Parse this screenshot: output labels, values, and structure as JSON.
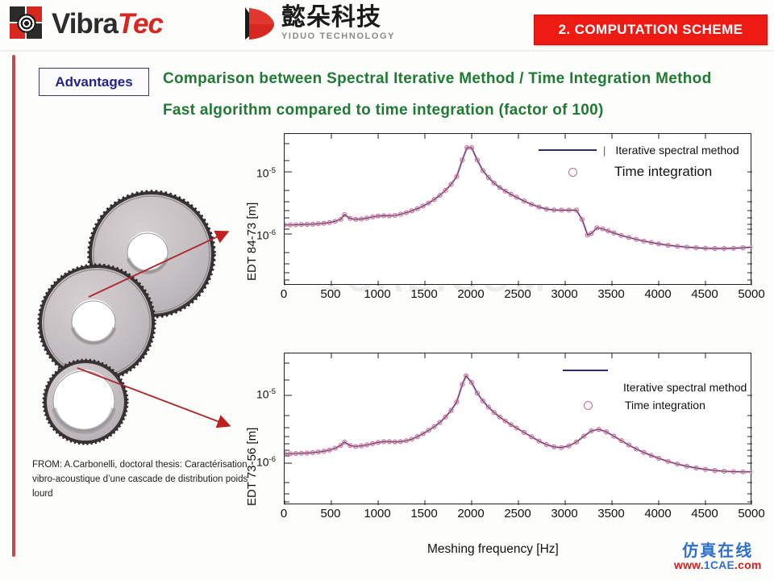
{
  "header": {
    "vibratec_logo_text": "VibraTec",
    "vibratec_name_main": "Vibra",
    "vibratec_name_accent": "Tec",
    "yiduo_cn": "懿朵科技",
    "yiduo_en": "YIDUO TECHNOLOGY",
    "banner_label": "2. COMPUTATION SCHEME",
    "banner_color": "#ee1b15"
  },
  "title": {
    "badge": "Advantages",
    "line1": "Comparison between  Spectral Iterative Method / Time Integration Method",
    "line2": "Fast algorithm compared to time integration  (factor of 100)",
    "color": "#1f7a33",
    "badge_color": "#231f8f"
  },
  "source_note": "FROM: A.Carbonelli,  doctoral thesis: Caractérisation vibro-acoustique d’une cascade de distribution poids lourd",
  "xlabel_shared": "Meshing  frequency [Hz]",
  "watermark": {
    "center": "1CAE.COM",
    "cn": "仿真在线",
    "url_prefix": "www.",
    "url_mid": "1CAE",
    "url_suffix": ".com"
  },
  "chart_data": [
    {
      "id": "top",
      "type": "line",
      "title": "",
      "xlabel": "Meshing  frequency [Hz]",
      "ylabel": "EDT 84-73 [m]",
      "xlim": [
        0,
        5000
      ],
      "ylim": [
        3e-07,
        5e-05
      ],
      "yscale": "log",
      "xticks": [
        0,
        500,
        1000,
        1500,
        2000,
        2500,
        3000,
        3500,
        4000,
        4500,
        5000
      ],
      "xticklabels": [
        "0",
        "500",
        "1000",
        "1500",
        "2000",
        "2500",
        "3000",
        "3500",
        "4000",
        "4500",
        "5000"
      ],
      "yticks": [
        1e-06,
        1e-05
      ],
      "yticklabels": [
        "10-6",
        "10-5"
      ],
      "grid": false,
      "legend_position": "upper right",
      "series": [
        {
          "name": "Iterative spectral method",
          "style": "line",
          "color": "#2b2f6e",
          "x": [
            0,
            60,
            120,
            180,
            240,
            300,
            360,
            420,
            480,
            540,
            600,
            640,
            700,
            760,
            820,
            880,
            940,
            1000,
            1060,
            1120,
            1180,
            1240,
            1300,
            1360,
            1420,
            1480,
            1540,
            1600,
            1660,
            1720,
            1780,
            1840,
            1900,
            1950,
            2000,
            2060,
            2120,
            2180,
            2240,
            2300,
            2360,
            2420,
            2480,
            2560,
            2640,
            2720,
            2800,
            2880,
            2960,
            3040,
            3120,
            3180,
            3240,
            3280,
            3340,
            3400,
            3460,
            3520,
            3600,
            3680,
            3760,
            3840,
            3920,
            4000,
            4100,
            4200,
            4300,
            4400,
            4500,
            4600,
            4700,
            4800,
            4900,
            5000
          ],
          "y": [
            1.4e-06,
            1.4e-06,
            1.41e-06,
            1.42e-06,
            1.43e-06,
            1.44e-06,
            1.46e-06,
            1.49e-06,
            1.53e-06,
            1.6e-06,
            1.72e-06,
            2.05e-06,
            1.78e-06,
            1.72e-06,
            1.74e-06,
            1.8e-06,
            1.88e-06,
            1.95e-06,
            1.97e-06,
            1.96e-06,
            1.99e-06,
            2.08e-06,
            2.2e-06,
            2.36e-06,
            2.56e-06,
            2.82e-06,
            3.15e-06,
            3.6e-06,
            4.2e-06,
            5.05e-06,
            6.3e-06,
            8.4e-06,
            1.55e-05,
            2.45e-05,
            2.45e-05,
            1.55e-05,
            1.05e-05,
            8.1e-06,
            6.6e-06,
            5.6e-06,
            4.9e-06,
            4.35e-06,
            3.9e-06,
            3.4e-06,
            3e-06,
            2.72e-06,
            2.52e-06,
            2.44e-06,
            2.42e-06,
            2.42e-06,
            2.42e-06,
            1.72e-06,
            9.6e-07,
            1.02e-06,
            1.26e-06,
            1.21e-06,
            1.12e-06,
            1.04e-06,
            9.5e-07,
            8.8e-07,
            8.2e-07,
            7.7e-07,
            7.3e-07,
            6.95e-07,
            6.6e-07,
            6.35e-07,
            6.15e-07,
            6e-07,
            5.9e-07,
            5.85e-07,
            5.85e-07,
            5.9e-07,
            6e-07,
            6.15e-07
          ]
        },
        {
          "name": "Time integration",
          "style": "markers",
          "color": "#c86a8e",
          "marker": "circle"
        }
      ]
    },
    {
      "id": "bottom",
      "type": "line",
      "title": "",
      "xlabel": "Meshing  frequency [Hz]",
      "ylabel": "EDT 73-56 [m]",
      "xlim": [
        0,
        5000
      ],
      "ylim": [
        3e-07,
        5e-05
      ],
      "yscale": "log",
      "xticks": [
        0,
        500,
        1000,
        1500,
        2000,
        2500,
        3000,
        3500,
        4000,
        4500,
        5000
      ],
      "xticklabels": [
        "0",
        "500",
        "1000",
        "1500",
        "2000",
        "2500",
        "3000",
        "3500",
        "4000",
        "4500",
        "5000"
      ],
      "yticks": [
        1e-06,
        1e-05
      ],
      "yticklabels": [
        "10-6",
        "10-5"
      ],
      "grid": false,
      "legend_position": "upper right",
      "series": [
        {
          "name": "Iterative spectral method",
          "style": "line",
          "color": "#2b2f6e",
          "x": [
            0,
            60,
            120,
            180,
            240,
            300,
            360,
            420,
            480,
            540,
            600,
            640,
            700,
            760,
            820,
            880,
            940,
            1000,
            1060,
            1120,
            1180,
            1240,
            1300,
            1360,
            1420,
            1480,
            1540,
            1600,
            1660,
            1720,
            1780,
            1840,
            1900,
            1940,
            2000,
            2060,
            2120,
            2180,
            2240,
            2300,
            2360,
            2420,
            2480,
            2560,
            2640,
            2720,
            2800,
            2880,
            2960,
            3040,
            3120,
            3200,
            3280,
            3360,
            3440,
            3520,
            3600,
            3680,
            3760,
            3840,
            3920,
            4000,
            4100,
            4200,
            4300,
            4400,
            4500,
            4600,
            4700,
            4800,
            4900,
            5000
          ],
          "y": [
            1.38e-06,
            1.38e-06,
            1.39e-06,
            1.4e-06,
            1.41e-06,
            1.43e-06,
            1.46e-06,
            1.5e-06,
            1.56e-06,
            1.66e-06,
            1.82e-06,
            2.05e-06,
            1.82e-06,
            1.76e-06,
            1.8e-06,
            1.86e-06,
            1.94e-06,
            2.02e-06,
            2.08e-06,
            2.08e-06,
            2.06e-06,
            2.08e-06,
            2.14e-06,
            2.26e-06,
            2.46e-06,
            2.72e-06,
            3.05e-06,
            3.45e-06,
            4e-06,
            4.8e-06,
            6e-06,
            8e-06,
            1.45e-05,
            1.95e-05,
            1.55e-05,
            1.08e-05,
            8.3e-06,
            6.7e-06,
            5.6e-06,
            4.8e-06,
            4.2e-06,
            3.7e-06,
            3.3e-06,
            2.85e-06,
            2.45e-06,
            2.12e-06,
            1.88e-06,
            1.74e-06,
            1.7e-06,
            1.8e-06,
            2.05e-06,
            2.5e-06,
            3e-06,
            3.15e-06,
            2.9e-06,
            2.5e-06,
            2.15e-06,
            1.85e-06,
            1.62e-06,
            1.44e-06,
            1.3e-06,
            1.18e-06,
            1.06e-06,
            9.7e-07,
            9e-07,
            8.5e-07,
            8.1e-07,
            7.8e-07,
            7.6e-07,
            7.5e-07,
            7.45e-07,
            7.45e-07
          ]
        },
        {
          "name": "Time integration",
          "style": "markers",
          "color": "#c86a8e",
          "marker": "circle"
        }
      ]
    }
  ]
}
